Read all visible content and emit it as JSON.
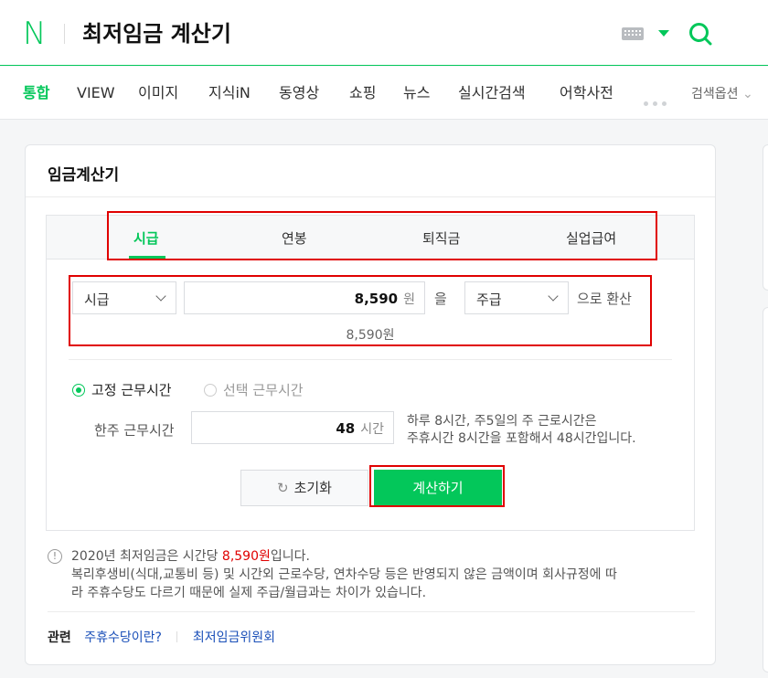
{
  "header": {
    "logo": "N",
    "query": "최저임금 계산기"
  },
  "nav": {
    "items": [
      "통합",
      "VIEW",
      "이미지",
      "지식iN",
      "동영상",
      "쇼핑",
      "뉴스",
      "실시간검색",
      "어학사전"
    ],
    "search_option": "검색옵션"
  },
  "card": {
    "title": "임금계산기",
    "tabs": [
      "시급",
      "연봉",
      "퇴직금",
      "실업급여"
    ],
    "convert": {
      "from_unit": "시급",
      "amount": "8,590",
      "currency": "원",
      "particle": "을",
      "to_unit": "주급",
      "suffix": "으로 환산",
      "result": "8,590원"
    },
    "radios": {
      "fixed": "고정 근무시간",
      "select": "선택 근무시간"
    },
    "weekly_hours": {
      "label": "한주 근무시간",
      "value": "48",
      "unit": "시간"
    },
    "description": {
      "line1": "하루 8시간, 주5일의 주 근로시간은",
      "line2": "주휴시간 8시간을 포함해서 48시간입니다."
    },
    "buttons": {
      "reset": "초기화",
      "calculate": "계산하기"
    },
    "notice": {
      "prefix": "2020년 최저임금은 시간당 ",
      "highlight": "8,590원",
      "suffix": "입니다.",
      "line2": "복리후생비(식대,교통비 등) 및 시간외 근로수당, 연차수당 등은 반영되지 않은 금액이며 회사규정에 따",
      "line3": "라 주휴수당도 다르기 때문에 실제 주급/월급과는 차이가 있습니다."
    },
    "related": {
      "label": "관련",
      "links": [
        "주휴수당이란?",
        "최저임금위원회"
      ]
    }
  },
  "colors": {
    "brand_green": "#03c75a",
    "highlight_red": "#e00000",
    "link_blue": "#1a4fb8"
  }
}
